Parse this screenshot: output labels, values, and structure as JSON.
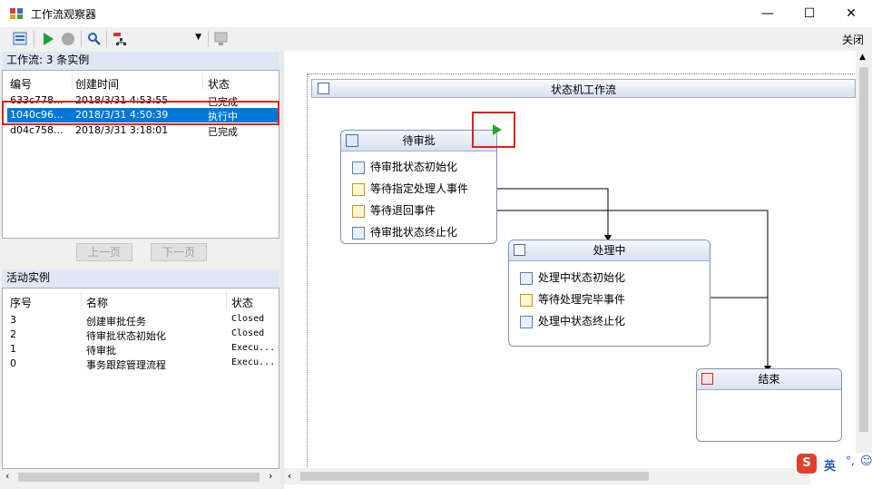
{
  "window": {
    "title": "工作流观察器",
    "minimize": "—",
    "maximize": "☐",
    "close": "✕"
  },
  "toolbar": {
    "close_label": "关闭"
  },
  "workflows": {
    "header": "工作流: 3 条实例",
    "columns": [
      "编号",
      "创建时间",
      "状态"
    ],
    "rows": [
      {
        "id": "633c778...",
        "time": "2018/3/31 4:53:55",
        "status": "已完成"
      },
      {
        "id": "1040c96...",
        "time": "2018/3/31 4:50:39",
        "status": "执行中"
      },
      {
        "id": "d04c758...",
        "time": "2018/3/31 3:18:01",
        "status": "已完成"
      }
    ],
    "selected_index": 1,
    "prev_label": "上一页",
    "next_label": "下一页"
  },
  "activities": {
    "header": "活动实例",
    "columns": [
      "序号",
      "名称",
      "状态"
    ],
    "rows": [
      {
        "no": "3",
        "name": "创建审批任务",
        "status": "Closed"
      },
      {
        "no": "2",
        "name": "待审批状态初始化",
        "status": "Closed"
      },
      {
        "no": "1",
        "name": "待审批",
        "status": "Execu..."
      },
      {
        "no": "0",
        "name": "事务跟踪管理流程",
        "status": "Execu..."
      }
    ]
  },
  "designer": {
    "workflow_title": "状态机工作流",
    "states": [
      {
        "title": "待审批",
        "activities": [
          "待审批状态初始化",
          "等待指定处理人事件",
          "等待退回事件",
          "待审批状态终止化"
        ]
      },
      {
        "title": "处理中",
        "activities": [
          "处理中状态初始化",
          "等待处理完毕事件",
          "处理中状态终止化"
        ]
      },
      {
        "title": "结束",
        "activities": []
      }
    ]
  },
  "ime": {
    "label": "英",
    "punct": "°,"
  },
  "colors": {
    "selection": "#0078d7",
    "highlight_box": "#e02020",
    "state_border": "#7a92b8",
    "run_arrow": "#2ca02c"
  }
}
